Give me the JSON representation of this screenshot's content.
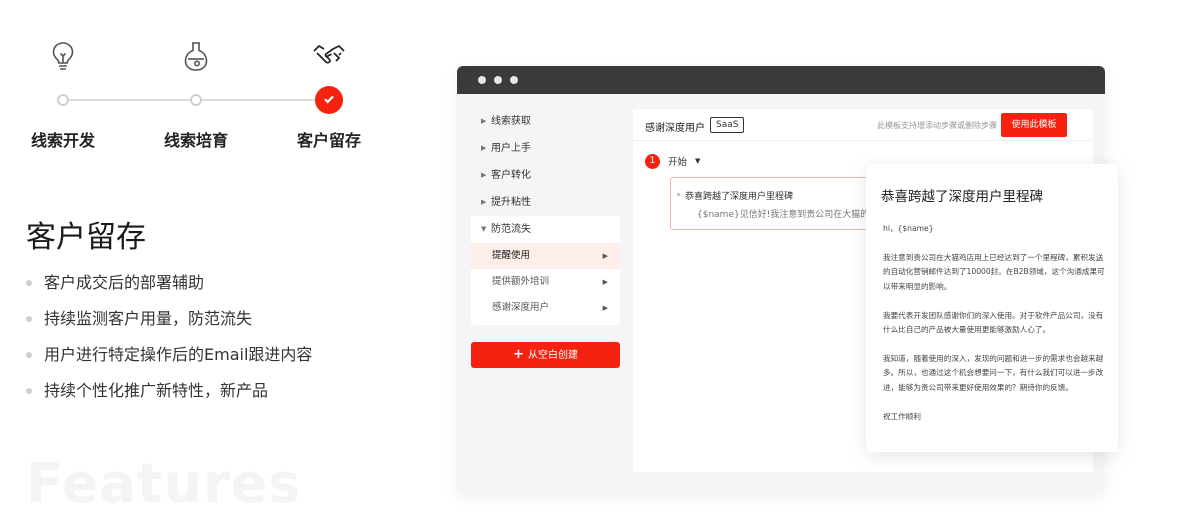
{
  "steps": [
    {
      "label": "线索开发",
      "icon": "lightbulb-icon",
      "active": false
    },
    {
      "label": "线索培育",
      "icon": "flask-icon",
      "active": false
    },
    {
      "label": "客户留存",
      "icon": "handshake-icon",
      "active": true
    }
  ],
  "feature": {
    "title": "客户留存",
    "bullets": [
      "客户成交后的部署辅助",
      "持续监测客户用量，防范流失",
      "用户进行特定操作后的Email跟进内容",
      "持续个性化推广新特性，新产品"
    ],
    "watermark": "Features"
  },
  "app": {
    "sidebar": {
      "items": [
        {
          "label": "线索获取"
        },
        {
          "label": "用户上手"
        },
        {
          "label": "客户转化"
        },
        {
          "label": "提升粘性"
        }
      ],
      "expanded_group": {
        "label": "防范流失",
        "sub_items": [
          {
            "label": "提醒使用",
            "active": true
          },
          {
            "label": "提供额外培训",
            "active": false
          },
          {
            "label": "感谢深度用户",
            "active": false
          }
        ]
      },
      "create_button": {
        "icon": "+",
        "label": "从空白创建"
      }
    },
    "main": {
      "title": "感谢深度用户",
      "tag": "SaaS",
      "hint": "此模板支持增添动步骤或删除步骤",
      "use_button": "使用此模板",
      "step_number": "1",
      "step_label": "开始",
      "card": {
        "title": "恭喜跨越了深度用户里程碑",
        "preview": "{$name}见信好!我注意到贵公司在大猫的"
      }
    },
    "popup": {
      "title": "恭喜跨越了深度用户里程碑",
      "paragraphs": [
        "hi，{$name}",
        "我注意到贵公司在大猫鸡店用上已经达到了一个里程碑，累积发送的自动化营销邮件达到了10000封。在B2B领域，这个沟通成果可以带来明显的影响。",
        "我要代表开发团队感谢你们的深入使用。对于软件产品公司，没有什么比自己的产品被大量使用更能够激励人心了。",
        "我知道，随着使用的深入，发现的问题和进一步的需求也会越来越多。所以，也通过这个机会想要问一下，有什么我们可以进一步改进，能够为贵公司带来更好使用效果的？期待你的反馈。",
        "祝工作顺利"
      ]
    }
  },
  "colors": {
    "accent": "#f5220f",
    "active_bg": "#fdeee9"
  }
}
